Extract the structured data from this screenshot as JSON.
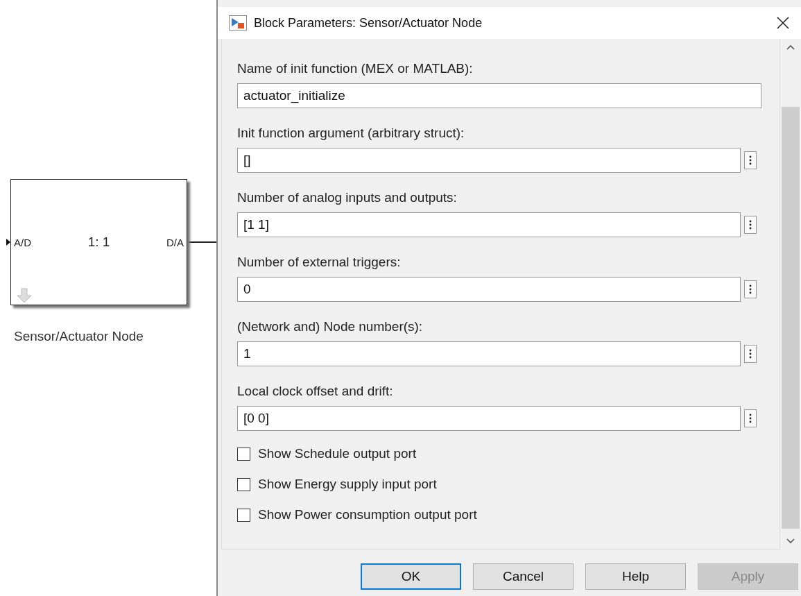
{
  "diagram": {
    "block": {
      "input_port": "A/D",
      "ratio": "1: 1",
      "output_port": "D/A",
      "name": "Sensor/Actuator Node"
    }
  },
  "dialog": {
    "title": "Block Parameters: Sensor/Actuator Node",
    "fields": [
      {
        "label": "Name of init function (MEX or MATLAB):",
        "value": "actuator_initialize",
        "kind": "plain"
      },
      {
        "label": "Init function argument (arbitrary struct):",
        "value": "[]",
        "kind": "menu"
      },
      {
        "label": "Number of analog inputs and outputs:",
        "value": "[1 1]",
        "kind": "menu"
      },
      {
        "label": "Number of external triggers:",
        "value": "0",
        "kind": "menu"
      },
      {
        "label": "(Network and) Node number(s):",
        "value": "1",
        "kind": "menu"
      },
      {
        "label": "Local clock offset and drift:",
        "value": "[0 0]",
        "kind": "menu"
      }
    ],
    "checkboxes": [
      {
        "label": "Show Schedule output port",
        "checked": false
      },
      {
        "label": "Show Energy supply input port",
        "checked": false
      },
      {
        "label": "Show Power consumption output port",
        "checked": false
      }
    ],
    "buttons": [
      {
        "label": "OK",
        "focused": true,
        "disabled": false
      },
      {
        "label": "Cancel",
        "focused": false,
        "disabled": false
      },
      {
        "label": "Help",
        "focused": false,
        "disabled": false
      },
      {
        "label": "Apply",
        "focused": false,
        "disabled": true
      }
    ]
  }
}
